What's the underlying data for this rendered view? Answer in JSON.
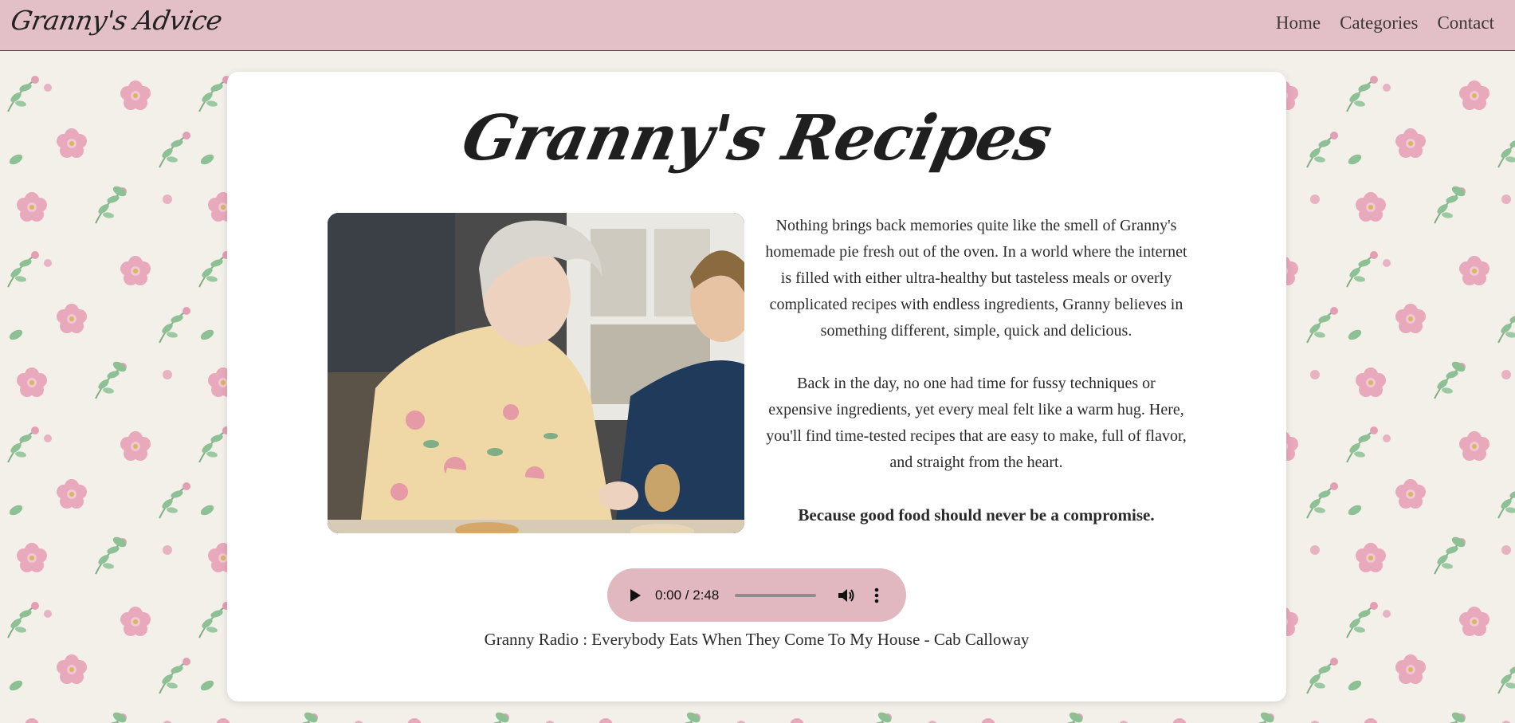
{
  "header": {
    "brand": "Granny's Advice",
    "nav": [
      {
        "label": "Home"
      },
      {
        "label": "Categories"
      },
      {
        "label": "Contact"
      }
    ]
  },
  "main": {
    "title": "Granny's Recipes",
    "photo_icon": "granny-peeling-potatoes-photo",
    "paragraphs": [
      "Nothing brings back memories quite like the smell of Granny's homemade pie fresh out of the oven. In a world where the internet is filled with either ultra-healthy but tasteless meals or overly complicated recipes with endless ingredients, Granny believes in something different, simple, quick and delicious.",
      "Back in the day, no one had time for fussy techniques or expensive ingredients, yet every meal felt like a warm hug. Here, you'll find time-tested recipes that are easy to make, full of flavor, and straight from the heart."
    ],
    "tagline": "Because good food should never be a compromise.",
    "player": {
      "time": "0:00 / 2:48",
      "progress": 0.0,
      "accent": "#e1b8c0"
    },
    "caption": "Granny Radio : Everybody Eats When They Come To My House - Cab Calloway"
  },
  "colors": {
    "header_bg": "#e3bfc7",
    "card_bg": "#ffffff",
    "wallpaper_bg": "#f3f0ea"
  }
}
